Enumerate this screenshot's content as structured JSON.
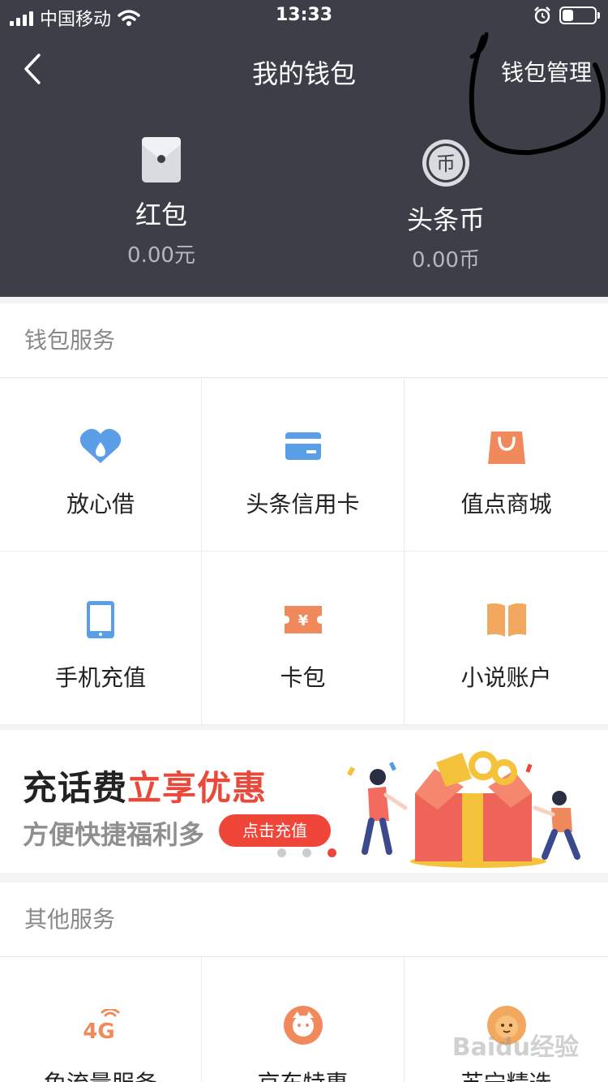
{
  "status_bar": {
    "carrier": "中国移动",
    "time": "13:33",
    "battery_level": 0.35
  },
  "nav": {
    "title": "我的钱包",
    "manage_label": "钱包管理"
  },
  "balances": [
    {
      "label": "红包",
      "value": "0.00元",
      "icon": "envelope-icon"
    },
    {
      "label": "头条币",
      "value": "0.00币",
      "icon": "coin-icon",
      "icon_text": "币"
    }
  ],
  "wallet_services": {
    "title": "钱包服务",
    "items": [
      {
        "label": "放心借",
        "icon": "loan-icon"
      },
      {
        "label": "头条信用卡",
        "icon": "credit-card-icon"
      },
      {
        "label": "值点商城",
        "icon": "shopping-bag-icon"
      },
      {
        "label": "手机充值",
        "icon": "phone-icon"
      },
      {
        "label": "卡包",
        "icon": "ticket-icon",
        "icon_text": "¥"
      },
      {
        "label": "小说账户",
        "icon": "book-icon"
      }
    ]
  },
  "banner": {
    "title_main": "充话费",
    "title_highlight": "立享优惠",
    "subtitle": "方便快捷福利多",
    "button_label": "点击充值",
    "active_dot": 2,
    "dot_count": 3
  },
  "other_services": {
    "title": "其他服务",
    "items": [
      {
        "label": "免流量服务",
        "icon": "4g-icon",
        "icon_text": "4G"
      },
      {
        "label": "京东特惠",
        "icon": "jd-icon"
      },
      {
        "label": "苏宁精选",
        "icon": "suning-icon"
      }
    ]
  },
  "watermark": "Baidu经验",
  "colors": {
    "header_bg": "#3c3f48",
    "accent_red": "#e8493a",
    "blue": "#5b9ee8",
    "orange": "#f08a5d"
  }
}
